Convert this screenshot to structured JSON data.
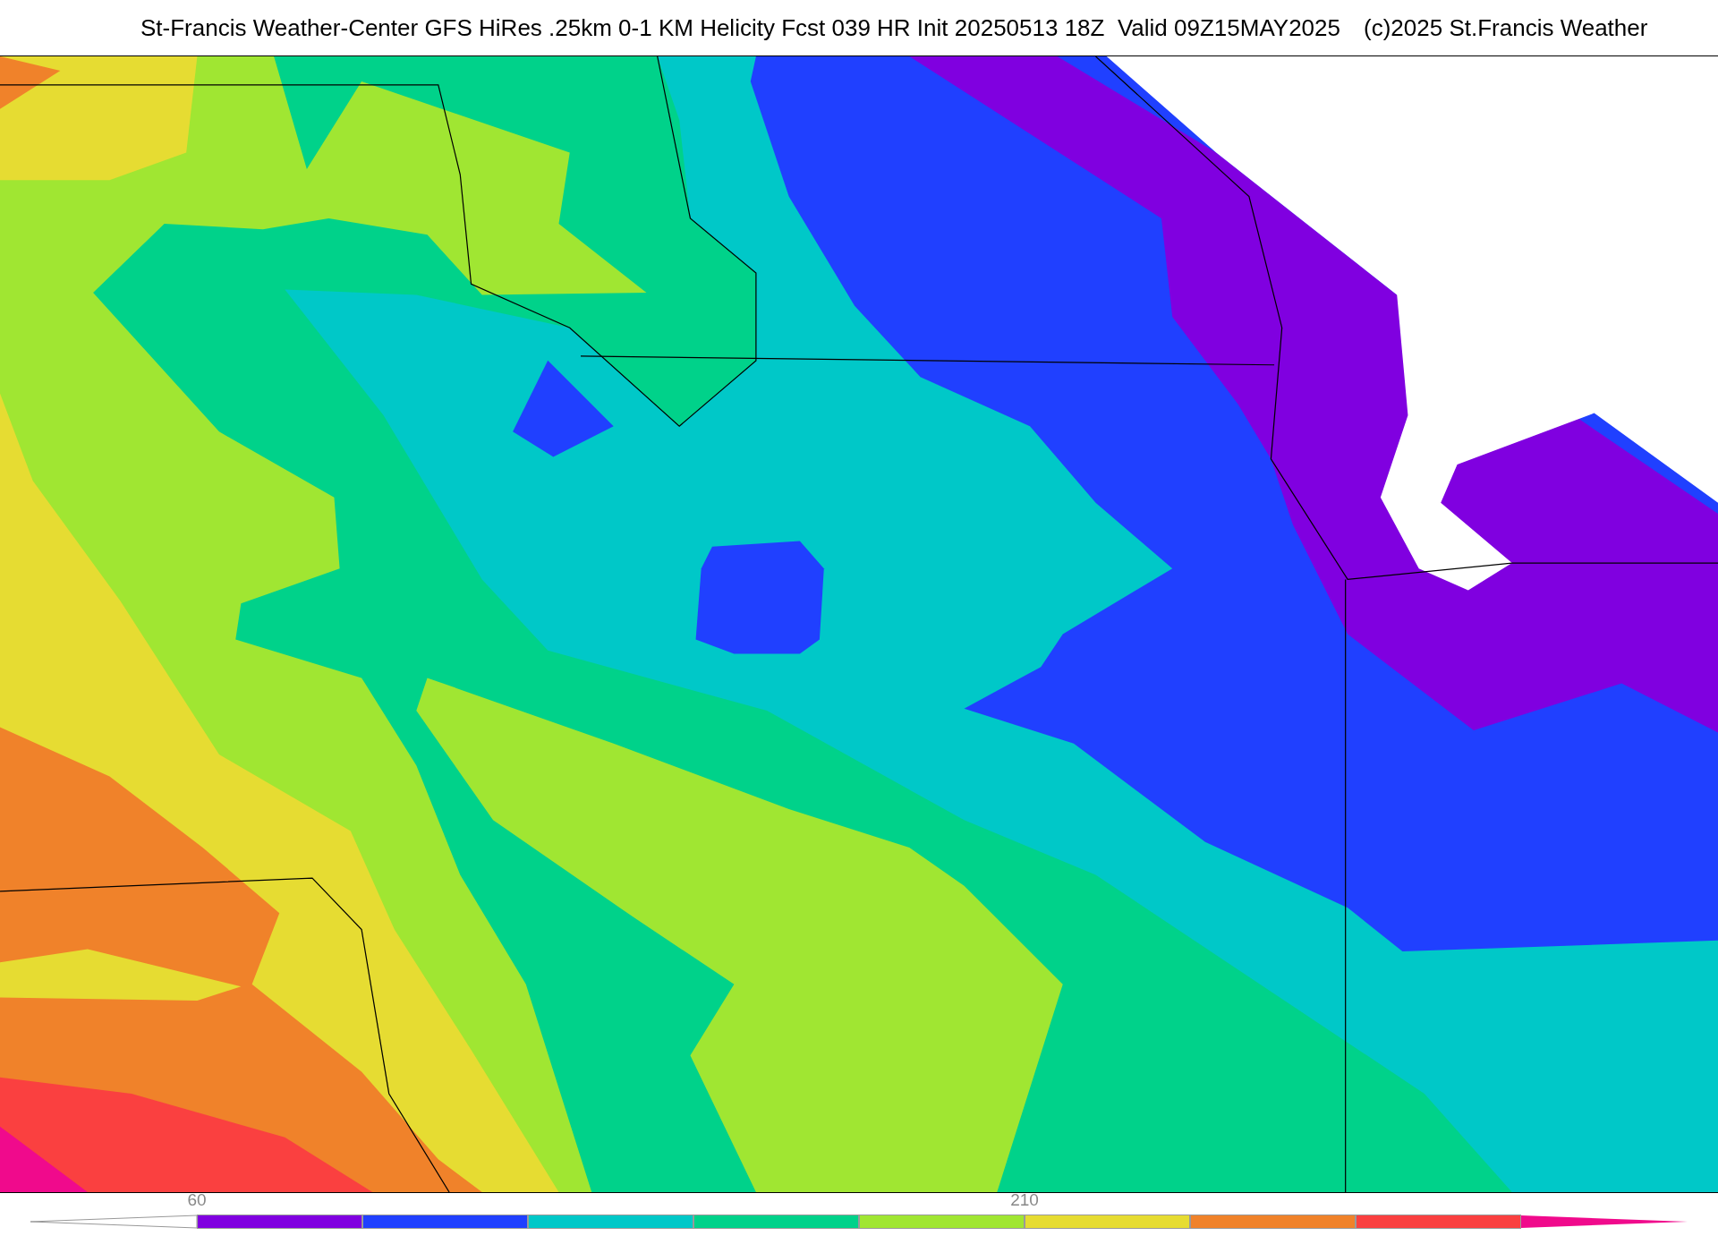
{
  "header": {
    "title": "St-Francis Weather-Center GFS HiRes .25km 0-1 KM Helicity Fcst 039 HR Init 20250513 18Z  Valid 09Z15MAY2025",
    "credit": "(c)2025 St.Francis Weather"
  },
  "colorbar": {
    "segments": [
      {
        "color": "#8000e0",
        "label": "60"
      },
      {
        "color": "#2040ff"
      },
      {
        "color": "#00c8c8"
      },
      {
        "color": "#00d28a"
      },
      {
        "color": "#a0e632"
      },
      {
        "color": "#e6dc32",
        "label": "210"
      },
      {
        "color": "#f0822a"
      },
      {
        "color": "#fa4040"
      }
    ],
    "end_arrow": {
      "color": "#f00a8c"
    }
  }
}
